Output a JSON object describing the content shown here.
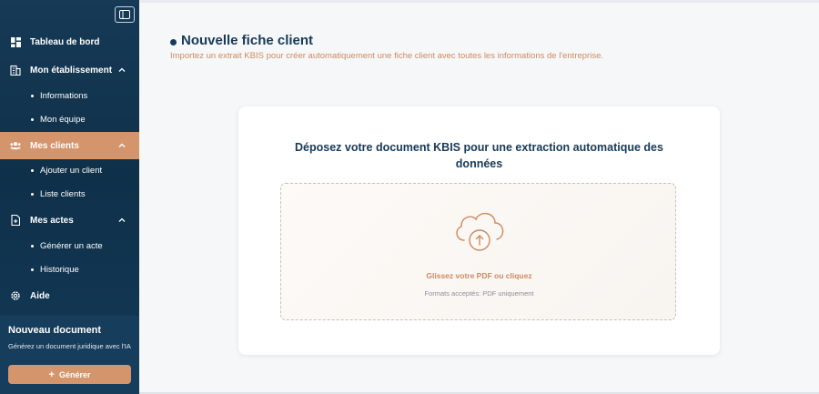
{
  "sidebar": {
    "nav": [
      {
        "label": "Tableau de bord",
        "icon": "dashboard-icon"
      },
      {
        "label": "Mon établissement",
        "icon": "building-icon"
      },
      {
        "label": "Mes clients",
        "icon": "users-icon"
      },
      {
        "label": "Mes actes",
        "icon": "document-add-icon"
      },
      {
        "label": "Aide",
        "icon": "gear-icon"
      }
    ],
    "etablissement_sub": [
      "Informations",
      "Mon équipe"
    ],
    "clients_sub": [
      "Ajouter un client",
      "Liste clients"
    ],
    "actes_sub": [
      "Générer un acte",
      "Historique"
    ],
    "new_doc": {
      "title": "Nouveau document",
      "description": "Générez un document juridique avec l'IA",
      "button_label": "Générer"
    }
  },
  "main": {
    "title": "Nouvelle fiche client",
    "subtitle": "Importez un extrait KBIS pour créer automatiquement une fiche client avec toutes les informations de l'entreprise.",
    "card": {
      "title": "Déposez votre document KBIS pour une extraction automatique des données",
      "drop_label": "Glissez votre PDF ou cliquez",
      "formats": "Formats acceptés: PDF uniquement"
    }
  },
  "colors": {
    "sidebar": "#163a57",
    "accent": "#d4956d",
    "title": "#163a57",
    "subtitle": "#cf8a5e"
  }
}
